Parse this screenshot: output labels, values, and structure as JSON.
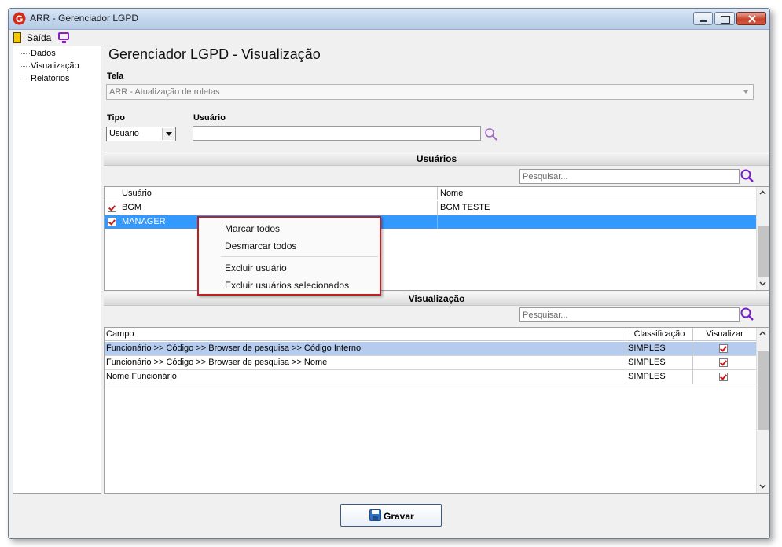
{
  "window": {
    "title": "ARR - Gerenciador LGPD"
  },
  "menubar": {
    "exit_label": "Saída"
  },
  "sidebar": {
    "items": [
      "Dados",
      "Visualização",
      "Relatórios"
    ]
  },
  "page": {
    "title": "Gerenciador LGPD - Visualização"
  },
  "tela": {
    "label": "Tela",
    "value": "ARR - Atualização de roletas"
  },
  "tipo": {
    "label": "Tipo",
    "value": "Usuário"
  },
  "usuario_filter": {
    "label": "Usuário",
    "value": ""
  },
  "usuarios_section": {
    "header": "Usuários",
    "search_placeholder": "Pesquisar...",
    "columns": [
      "Usuário",
      "Nome"
    ],
    "rows": [
      {
        "usuario": "BGM",
        "nome": "BGM TESTE",
        "checked": true,
        "selected": false
      },
      {
        "usuario": "MANAGER",
        "nome": "",
        "checked": true,
        "selected": true
      }
    ]
  },
  "context_menu": {
    "items": [
      "Marcar todos",
      "Desmarcar todos",
      "Excluir usuário",
      "Excluir usuários selecionados"
    ],
    "highlight_color": "#c01f1f"
  },
  "visualizacao_section": {
    "header": "Visualização",
    "search_placeholder": "Pesquisar...",
    "columns": [
      "Campo",
      "Classificação",
      "Visualizar"
    ],
    "rows": [
      {
        "campo": "Funcionário >> Código >> Browser de pesquisa >> Código Interno",
        "classificacao": "SIMPLES",
        "visualizar": true,
        "selected": true
      },
      {
        "campo": "Funcionário >> Código >> Browser de pesquisa >> Nome",
        "classificacao": "SIMPLES",
        "visualizar": true,
        "selected": false
      },
      {
        "campo": "Nome Funcionário",
        "classificacao": "SIMPLES",
        "visualizar": true,
        "selected": false
      }
    ]
  },
  "footer": {
    "save_label": "Gravar"
  },
  "colors": {
    "selection_blue": "#3399ff",
    "selection_light": "#b6ccef",
    "accent_purple": "#8a1fc1"
  }
}
